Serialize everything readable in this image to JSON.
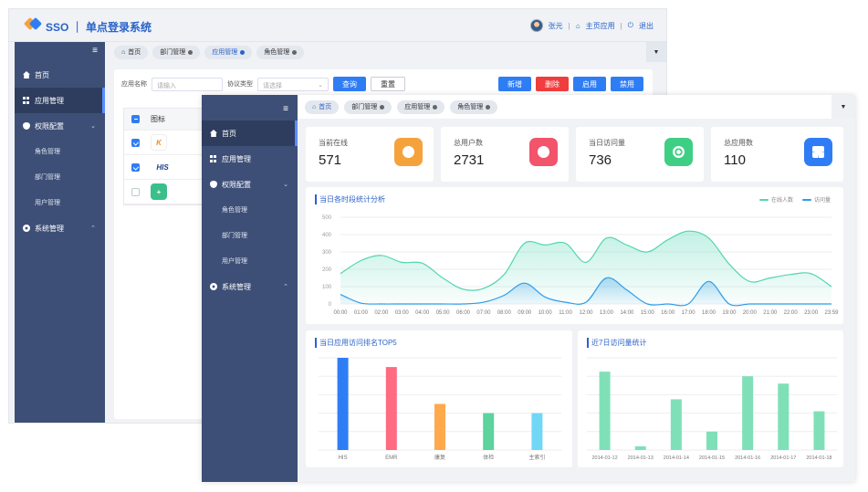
{
  "back": {
    "app_title": "SSO ｜ 单点登录系统",
    "user": {
      "name": "张元",
      "home_link": "主页应用",
      "logout": "退出"
    },
    "sidebar": {
      "items": [
        {
          "label": "首页"
        },
        {
          "label": "应用管理"
        },
        {
          "label": "权限配置",
          "sub": [
            "角色管理",
            "部门管理",
            "用户管理"
          ]
        },
        {
          "label": "系统管理"
        }
      ]
    },
    "tags": [
      "首页",
      "部门管理",
      "应用管理",
      "角色管理"
    ],
    "filter": {
      "app_name_label": "应用名称",
      "app_name_placeholder": "请输入",
      "protocol_label": "协议类型",
      "protocol_placeholder": "请选择",
      "query": "查询",
      "reset": "重置"
    },
    "actions": {
      "add": "新增",
      "delete": "删除",
      "enable": "启用",
      "disable": "禁用"
    },
    "table": {
      "header": "图标",
      "rows": [
        {
          "icon": "K"
        },
        {
          "icon": "HIS"
        },
        {
          "icon": "+"
        }
      ]
    }
  },
  "front": {
    "sidebar": {
      "items": [
        {
          "label": "首页"
        },
        {
          "label": "应用管理"
        },
        {
          "label": "权限配置",
          "sub": [
            "角色管理",
            "部门管理",
            "用户管理"
          ]
        },
        {
          "label": "系统管理"
        }
      ]
    },
    "tags": [
      "首页",
      "部门管理",
      "应用管理",
      "角色管理"
    ],
    "stats": [
      {
        "label": "当前在线",
        "value": "571",
        "color": "#f6a23c"
      },
      {
        "label": "总用户数",
        "value": "2731",
        "color": "#f2546b"
      },
      {
        "label": "当日访问量",
        "value": "736",
        "color": "#3ecf84"
      },
      {
        "label": "总应用数",
        "value": "110",
        "color": "#2f7df5"
      }
    ],
    "charts_titles": {
      "hourly": "当日各时段统计分析",
      "top5": "当日应用访问排名TOP5",
      "week": "近7日访问量统计"
    }
  },
  "chart_data": [
    {
      "type": "area",
      "title": "当日各时段统计分析",
      "x": [
        "00:00",
        "01:00",
        "02:00",
        "03:00",
        "04:00",
        "05:00",
        "06:00",
        "07:00",
        "08:00",
        "09:00",
        "10:00",
        "11:00",
        "12:00",
        "13:00",
        "14:00",
        "15:00",
        "16:00",
        "17:00",
        "18:00",
        "19:00",
        "20:00",
        "21:00",
        "22:00",
        "23:00",
        "23:59"
      ],
      "ylim": [
        0,
        500
      ],
      "yticks": [
        0,
        100,
        200,
        300,
        400,
        500
      ],
      "legend": "top-right",
      "series": [
        {
          "name": "在线人数",
          "color": "#52d6b0",
          "values": [
            175,
            250,
            280,
            240,
            235,
            150,
            85,
            90,
            170,
            350,
            340,
            350,
            240,
            380,
            340,
            300,
            370,
            420,
            380,
            230,
            130,
            150,
            170,
            175,
            100
          ]
        },
        {
          "name": "访问量",
          "color": "#2f9be8",
          "values": [
            55,
            5,
            0,
            0,
            0,
            0,
            0,
            10,
            50,
            120,
            40,
            10,
            10,
            150,
            80,
            0,
            0,
            0,
            130,
            0,
            0,
            0,
            0,
            0,
            0
          ]
        }
      ]
    },
    {
      "type": "bar",
      "title": "当日应用访问排名TOP5",
      "categories": [
        "HIS",
        "EMR",
        "康复",
        "体检",
        "主索引"
      ],
      "values": [
        100,
        90,
        50,
        40,
        40
      ],
      "colors": [
        "#2f7df5",
        "#ff6b81",
        "#ffa94d",
        "#5dd39e",
        "#72d7f7"
      ],
      "ylim": [
        0,
        100
      ]
    },
    {
      "type": "bar",
      "title": "近7日访问量统计",
      "categories": [
        "2014-01-12",
        "2014-01-13",
        "2014-01-14",
        "2014-01-15",
        "2014-01-16",
        "2014-01-17",
        "2014-01-18"
      ],
      "values": [
        85,
        4,
        55,
        20,
        80,
        72,
        42
      ],
      "color": "#7fe0b7",
      "ylim": [
        0,
        100
      ]
    }
  ]
}
